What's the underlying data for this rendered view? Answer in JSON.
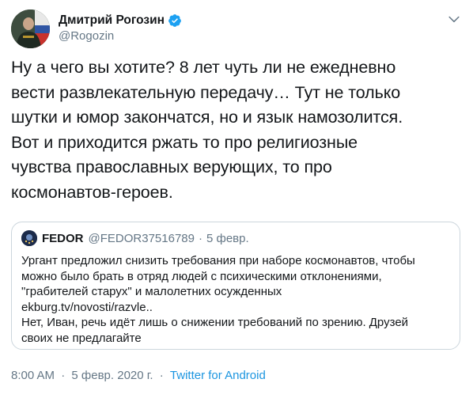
{
  "author": {
    "display_name": "Дмитрий Рогозин",
    "handle": "@Rogozin",
    "avatar_icon": "profile-photo",
    "verified_icon": "verified-badge-icon"
  },
  "menu_icon": "chevron-down-icon",
  "tweet": {
    "lines": [
      "Ну а чего вы хотите? 8 лет чуть ли не ежедневно",
      "вести развлекательную передачу… Тут не только",
      "шутки и юмор закончатся, но и язык намозолится.",
      "Вот и приходится ржать то про религиозные",
      "чувства православных верующих, то про",
      "космонавтов-героев."
    ]
  },
  "quote": {
    "display_name": "FEDOR",
    "handle": "@FEDOR37516789",
    "separator": "·",
    "date": "5 февр.",
    "lines": [
      "Ургант предложил снизить требования при наборе космонавтов, чтобы",
      "можно было брать в отряд людей с психическими отклонениями,",
      "\"грабителей старух\" и малолетних осужденных",
      "ekburg.tv/novosti/razvle..",
      "Нет, Иван, речь идёт лишь о снижении требований по зрению. Друзей",
      "своих не предлагайте"
    ]
  },
  "meta": {
    "time": "8:00 AM",
    "separator": "·",
    "date": "5 февр. 2020 г.",
    "separator2": "·",
    "source": "Twitter for Android"
  },
  "colors": {
    "text": "#14171a",
    "secondary": "#657786",
    "link": "#1b95e0",
    "verified": "#1da1f2",
    "border": "#ccd6dd"
  }
}
